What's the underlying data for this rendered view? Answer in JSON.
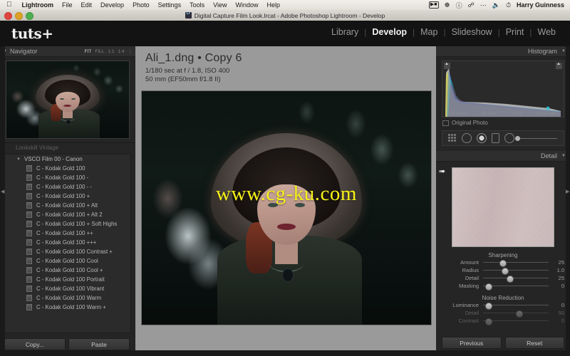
{
  "macmenu": {
    "apple_icon": "apple-logo",
    "items": [
      "Lightroom",
      "File",
      "Edit",
      "Develop",
      "Photo",
      "Settings",
      "Tools",
      "View",
      "Window",
      "Help"
    ],
    "status_icons": [
      "screen-record-icon",
      "dropbox-icon",
      "info-icon",
      "bluetooth-share-icon",
      "ellipsis-icon",
      "volume-icon",
      "time-machine-icon"
    ],
    "user": "Harry Guinness"
  },
  "window": {
    "title": "Digital Capture Film Look.lrcat - Adobe Photoshop Lightroom - Develop",
    "app_icon": "lightroom-icon"
  },
  "topbar": {
    "logo": "tuts+",
    "modules": [
      {
        "label": "Library",
        "active": false
      },
      {
        "label": "Develop",
        "active": true
      },
      {
        "label": "Map",
        "active": false
      },
      {
        "label": "Slideshow",
        "active": false
      },
      {
        "label": "Print",
        "active": false
      },
      {
        "label": "Web",
        "active": false
      }
    ],
    "separator": "|"
  },
  "navigator": {
    "title": "Navigator",
    "zoom_levels": [
      "FIT",
      "FILL",
      "1:1",
      "1:4"
    ],
    "active_zoom": "FIT"
  },
  "presets": {
    "partial_group_above": "Lookskill Vintage",
    "group": "VSCO Film 00 - Canon",
    "items": [
      "C - Kodak Gold 100",
      "C - Kodak Gold 100 -",
      "C - Kodak Gold 100 - -",
      "C - Kodak Gold 100 +",
      "C - Kodak Gold 100 + Alt",
      "C - Kodak Gold 100 + Alt 2",
      "C - Kodak Gold 100 + Soft Highs",
      "C - Kodak Gold 100 ++",
      "C - Kodak Gold 100 +++",
      "C - Kodak Gold 100 Contrast +",
      "C - Kodak Gold 100 Cool",
      "C - Kodak Gold 100 Cool +",
      "C - Kodak Gold 100 Portrait",
      "C - Kodak Gold 100 Vibrant",
      "C - Kodak Gold 100 Warm",
      "C - Kodak Gold 100 Warm +"
    ],
    "copy_button": "Copy...",
    "paste_button": "Paste"
  },
  "photo_info": {
    "filename": "Ali_1.dng",
    "separator": "•",
    "copy": "Copy 6",
    "exposure": "1/180 sec at f / 1.8, ISO 400",
    "lens": "50 mm (EF50mm f/1.8 II)",
    "watermark": "www.cg-ku.com"
  },
  "histogram": {
    "title": "Histogram",
    "iso": "ISO 400",
    "focal": "50 mm",
    "aperture": "f / 1.8",
    "shutter": "1/180 sec",
    "original_photo": "Original Photo"
  },
  "toolstrip": {
    "tools": [
      "crop-overlay-icon",
      "spot-removal-icon",
      "red-eye-icon",
      "graduated-filter-icon",
      "radial-filter-icon",
      "adjustment-brush-icon"
    ]
  },
  "detail": {
    "title": "Detail",
    "preview_icon": "loupe-target-icon",
    "sharpening": {
      "title": "Sharpening",
      "sliders": [
        {
          "label": "Amount",
          "value": "25",
          "pct": 25,
          "disabled": false
        },
        {
          "label": "Radius",
          "value": "1.0",
          "pct": 28,
          "disabled": false
        },
        {
          "label": "Detail",
          "value": "25",
          "pct": 36,
          "disabled": false
        },
        {
          "label": "Masking",
          "value": "0",
          "pct": 3,
          "disabled": false
        }
      ]
    },
    "noise_reduction": {
      "title": "Noise Reduction",
      "sliders": [
        {
          "label": "Luminance",
          "value": "0",
          "pct": 3,
          "disabled": false
        },
        {
          "label": "Detail",
          "value": "50",
          "pct": 50,
          "disabled": true
        },
        {
          "label": "Contrast",
          "value": "0",
          "pct": 3,
          "disabled": true
        }
      ]
    },
    "previous_button": "Previous",
    "reset_button": "Reset"
  },
  "colors": {
    "panel_bg": "#252525",
    "canvas_bg": "#9a9a9a",
    "watermark": "#f7f218",
    "accent_text": "#f2f2f2"
  }
}
